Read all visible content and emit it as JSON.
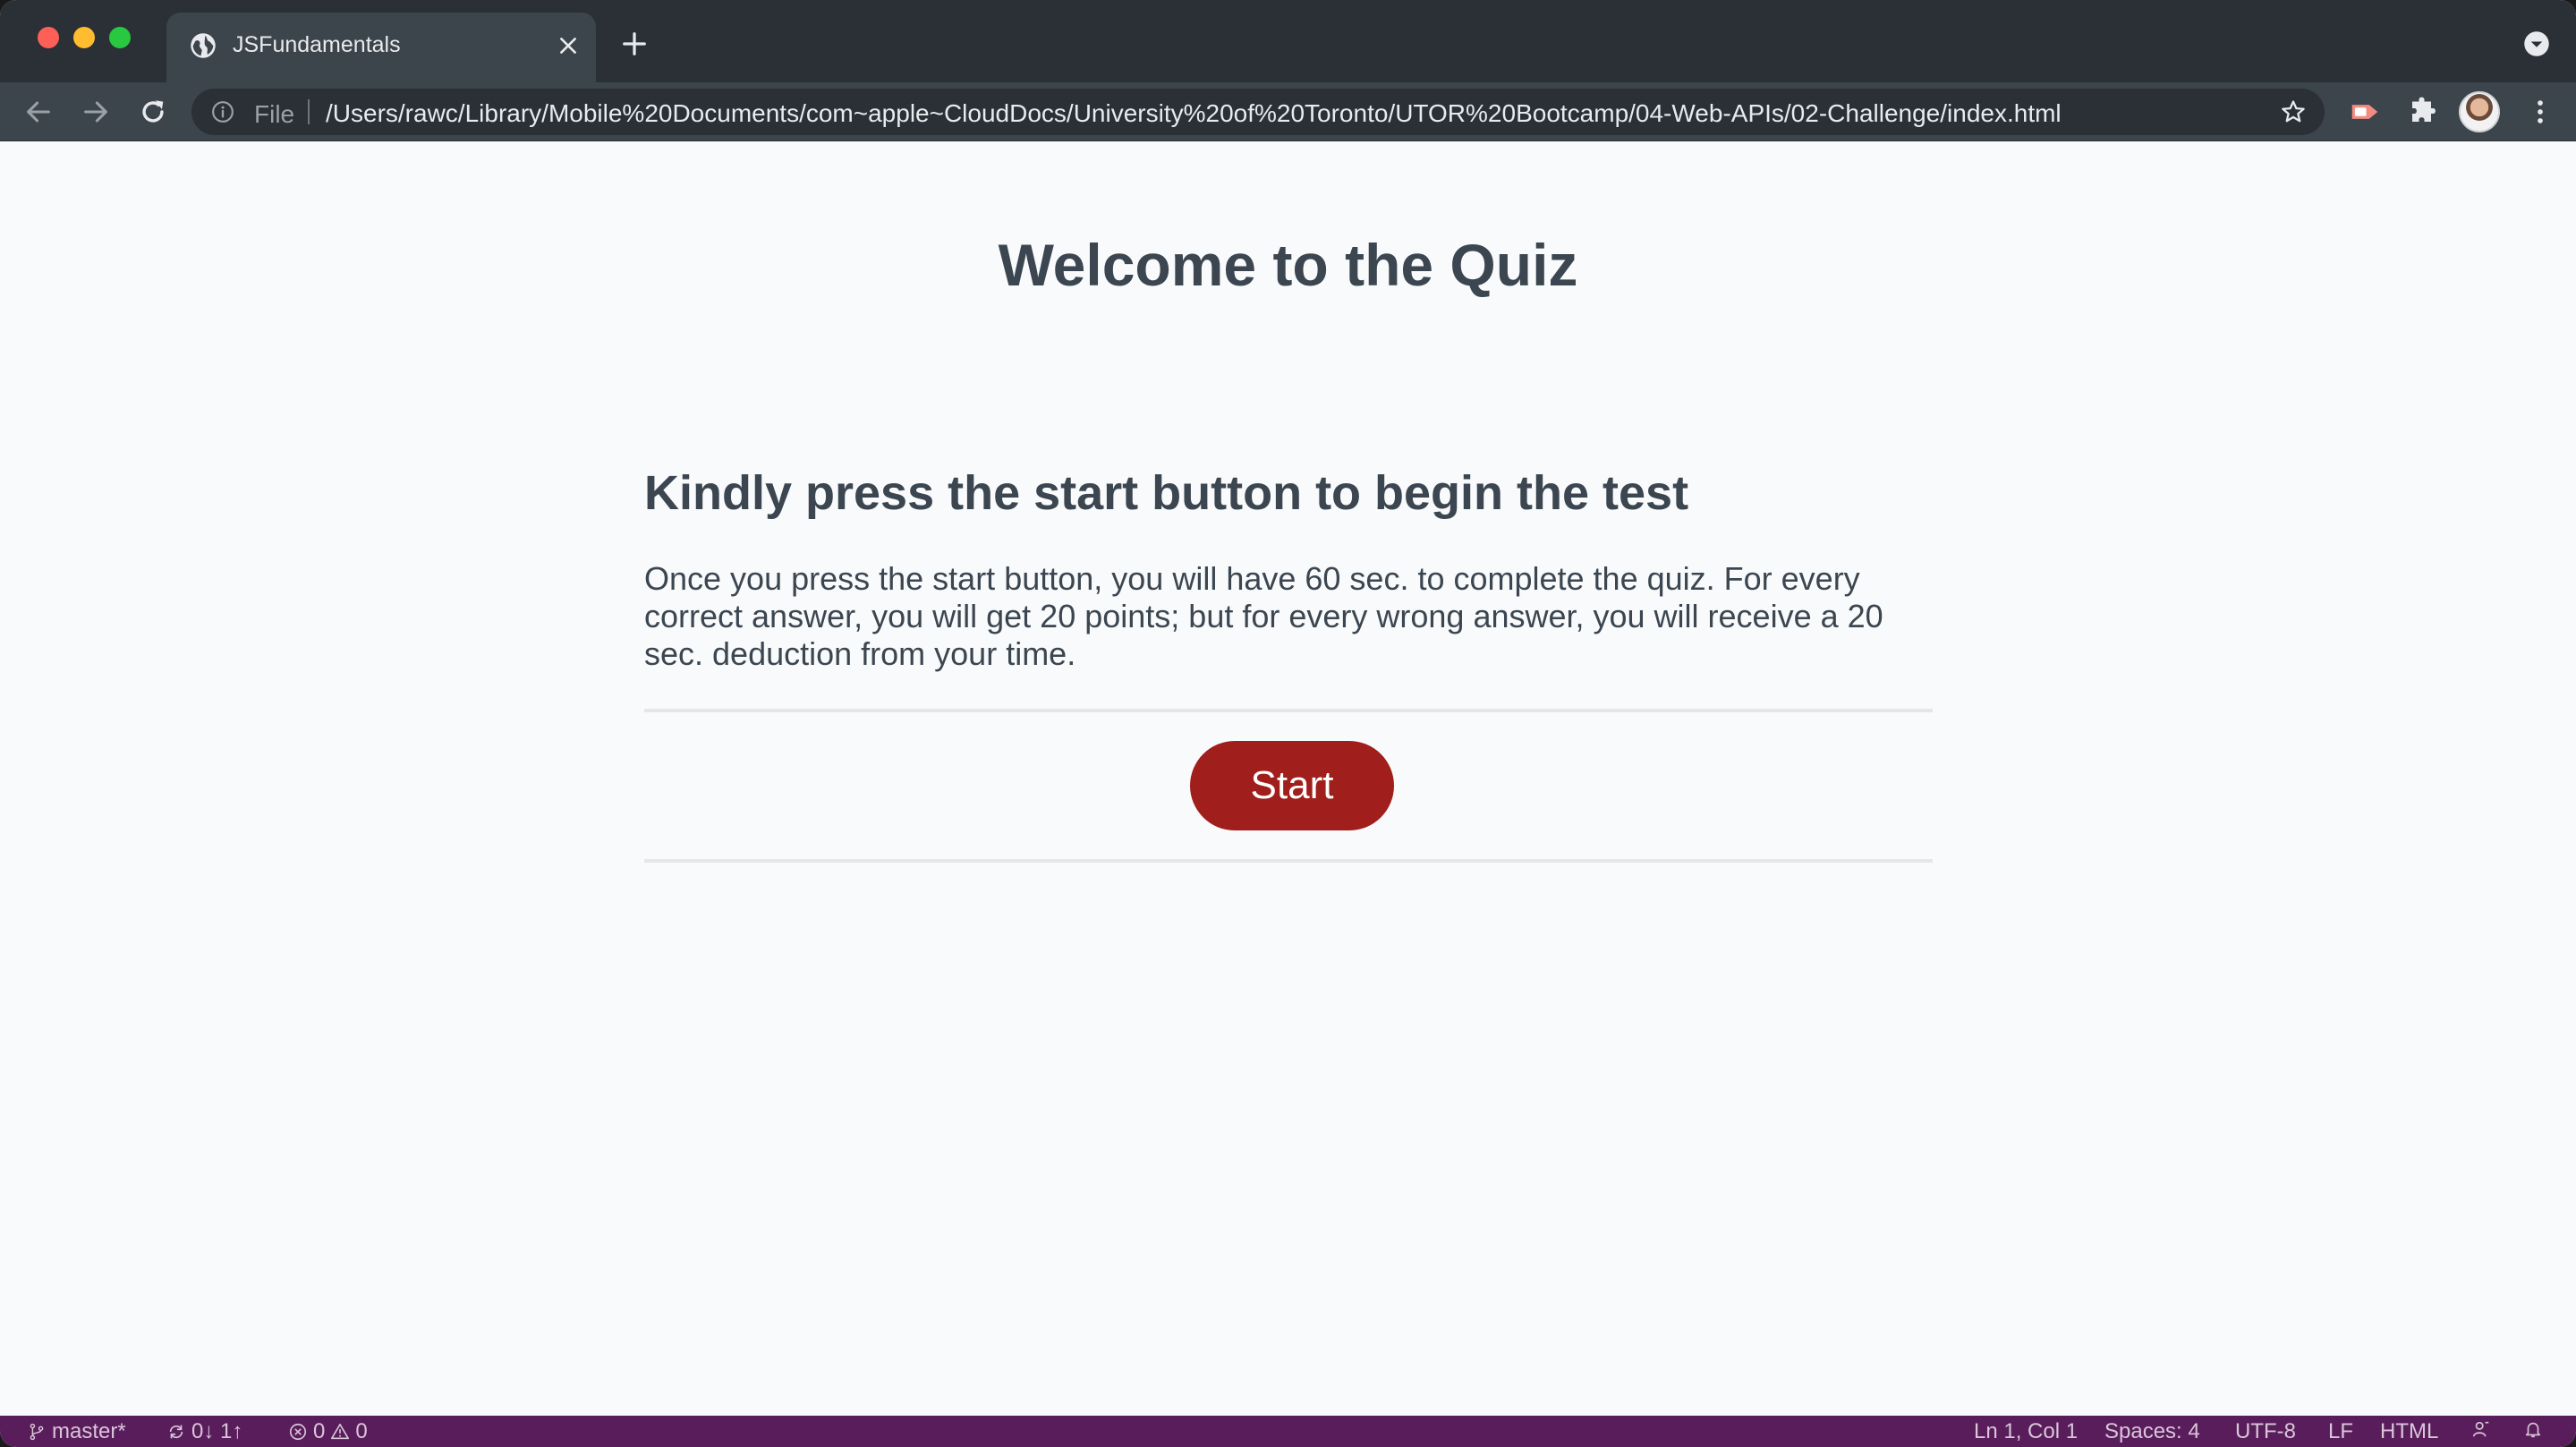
{
  "browser": {
    "tab_title": "JSFundamentals",
    "omnibox_scheme": "File",
    "url": "/Users/rawc/Library/Mobile%20Documents/com~apple~CloudDocs/University%20of%20Toronto/UTOR%20Bootcamp/04-Web-APIs/02-Challenge/index.html"
  },
  "page": {
    "title": "Welcome to the Quiz",
    "heading": "Kindly press the start button to begin the test",
    "instructions": "Once you press the start button, you will have 60 sec. to complete the quiz. For every correct answer, you will get 20 points; but for every wrong answer, you will receive a 20 sec. deduction from your time.",
    "start_label": "Start"
  },
  "statusbar": {
    "branch": "master*",
    "sync": "0↓ 1↑",
    "errors": "0",
    "warnings": "0",
    "cursor": "Ln 1, Col 1",
    "spaces": "Spaces: 4",
    "encoding": "UTF-8",
    "eol": "LF",
    "language": "HTML"
  },
  "colors": {
    "accent": "#a01e1b",
    "heading_text": "#3b4650",
    "statusbar": "#5a1d5c",
    "browser_chrome": "#2a3036"
  }
}
